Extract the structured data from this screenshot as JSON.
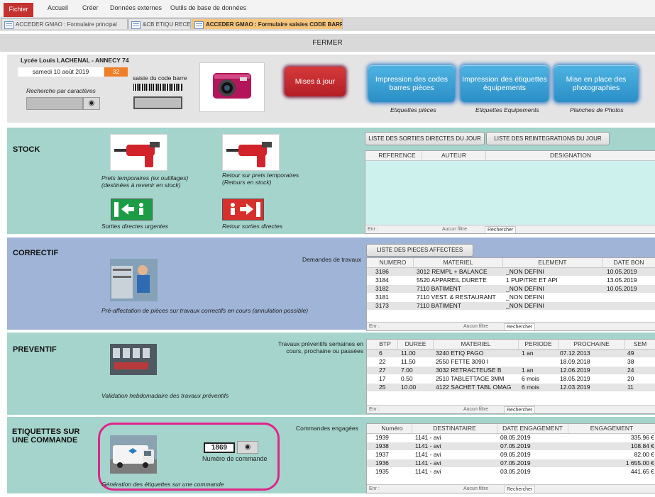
{
  "ribbon": {
    "tabs": [
      "Fichier",
      "Accueil",
      "Créer",
      "Données externes",
      "Outils de base de données"
    ]
  },
  "doctabs": [
    {
      "label": "ACCEDER GMAO : Formulaire principal"
    },
    {
      "label": "&CB ETIQU RECEP"
    },
    {
      "label": "ACCEDER GMAO : Formulaire saisies CODE BARRE"
    }
  ],
  "closebar": {
    "label": "FERMER"
  },
  "header": {
    "school": "Lycée Louis LACHENAL - ANNECY 74",
    "date": "samedi 10 août 2019",
    "week": "32",
    "search_label": "Recherche par caractères",
    "barcode_label": "saisie du code barre",
    "update_button": "Mises à jour",
    "buttons": [
      {
        "label": "Impression des codes barres pièces",
        "caption": "Etiquettes pièces"
      },
      {
        "label": "Impression des étiquettes équipements",
        "caption": "Etiquettes Equipements"
      },
      {
        "label": "Mise en place des photographies",
        "caption": "Planches de Photos"
      }
    ]
  },
  "stock": {
    "title": "STOCK",
    "caption_prets": "Prets temporaires (ex outillages) (destinées à revenir en stock)",
    "caption_retour": "Retour sur prets temporaires (Retours en stock)",
    "caption_sorties": "Sorties directes urgentes",
    "caption_retour_sorties": "Retour sorties directes",
    "btn_sorties": "LISTE DES SORTIES DIRECTES DU JOUR",
    "btn_reintegrations": "LISTE DES REINTEGRATIONS DU JOUR",
    "columns": [
      "REFERENCE",
      "AUTEUR",
      "DESIGNATION"
    ],
    "nav": {
      "record": "Enr :",
      "filter": "Aucun filtre",
      "search": "Rechercher"
    }
  },
  "correctif": {
    "title": "CORRECTIF",
    "demandes_label": "Demandes de travaux",
    "btn_pieces": "LISTE DES PIECES AFFECTEES",
    "caption": "Pré-affectation de pièces sur travaux correctifs en cours (annulation possible)",
    "columns": [
      "NUMERO",
      "MATERIEL",
      "ELEMENT",
      "DATE BON"
    ],
    "rows": [
      [
        "3186",
        "3012 REMPL + BALANCE",
        "_NON DEFINI",
        "10.05.2019"
      ],
      [
        "3184",
        "5520 APPAREIL DURETE",
        "1 PUPITRE ET API",
        "13.05.2019"
      ],
      [
        "3182",
        "7110 BATIMENT",
        "_NON DEFINI",
        "10.05.2019"
      ],
      [
        "3181",
        "7110 VEST. & RESTAURANT",
        "_NON DEFINI",
        ""
      ],
      [
        "3173",
        "7110 BATIMENT",
        "_NON DEFINI",
        ""
      ]
    ],
    "nav": {
      "record": "Enr :",
      "filter": "Aucun filtre",
      "search": "Rechercher"
    }
  },
  "preventif": {
    "title": "PREVENTIF",
    "label": "Travaux préventifs semaines en cours, prochaine ou passées",
    "caption": "Validation hebdomadaire des travaux préventifs",
    "columns": [
      "BTP",
      "DUREE",
      "MATERIEL",
      "PERIODE",
      "PROCHAINE",
      "SEM"
    ],
    "rows": [
      [
        "6",
        "11.00",
        "3240 ETIQ PAGO",
        "1 an",
        "07.12.2013",
        "49"
      ],
      [
        "22",
        "11.50",
        "2550 FETTE 3090 I",
        "",
        "18.09.2018",
        "38"
      ],
      [
        "27",
        "7.00",
        "3032 RETRACTEUSE B",
        "1 an",
        "12.06.2019",
        "24"
      ],
      [
        "17",
        "0.50",
        "2510 TABLETTAGE 3MM",
        "6 mois",
        "18.05.2019",
        "20"
      ],
      [
        "25",
        "10.00",
        "4122 SACHET TABL OMAG",
        "6 mois",
        "12.03.2019",
        "11"
      ]
    ],
    "nav": {
      "record": "Enr :",
      "filter": "Aucun filtre",
      "search": "Rechercher"
    }
  },
  "etiquettes": {
    "title": "ETIQUETTES SUR UNE COMMANDE",
    "commandes_label": "Commandes engagées",
    "order_number": "1869",
    "order_label": "Numéro de commande",
    "caption": "Génération des étiquettes sur une commande",
    "columns": [
      "Numéro",
      "DESTINATAIRE",
      "DATE ENGAGEMENT",
      "ENGAGEMENT"
    ],
    "rows": [
      [
        "1939",
        "1141 - avi",
        "08.05.2019",
        "335.96 €"
      ],
      [
        "1938",
        "1141 - avi",
        "07.05.2019",
        "108.84 €"
      ],
      [
        "1937",
        "1141 - avi",
        "09.05.2019",
        "82.00 €"
      ],
      [
        "1936",
        "1141 - avi",
        "07.05.2019",
        "1 655.00 €"
      ],
      [
        "1935",
        "1141 - avi",
        "03.05.2019",
        "441.65 €"
      ]
    ],
    "nav": {
      "record": "Enr :",
      "filter": "Aucun filtre",
      "search": "Rechercher"
    }
  },
  "colors": {
    "accent_file": "#c4322f",
    "active_tab": "#f8c57a",
    "teal_panel": "#a4d4cc",
    "blue_panel": "#9fb4d6",
    "blue_button": "#2a8fc6",
    "red_button": "#c8292e",
    "highlight_ring": "#e0248a"
  }
}
